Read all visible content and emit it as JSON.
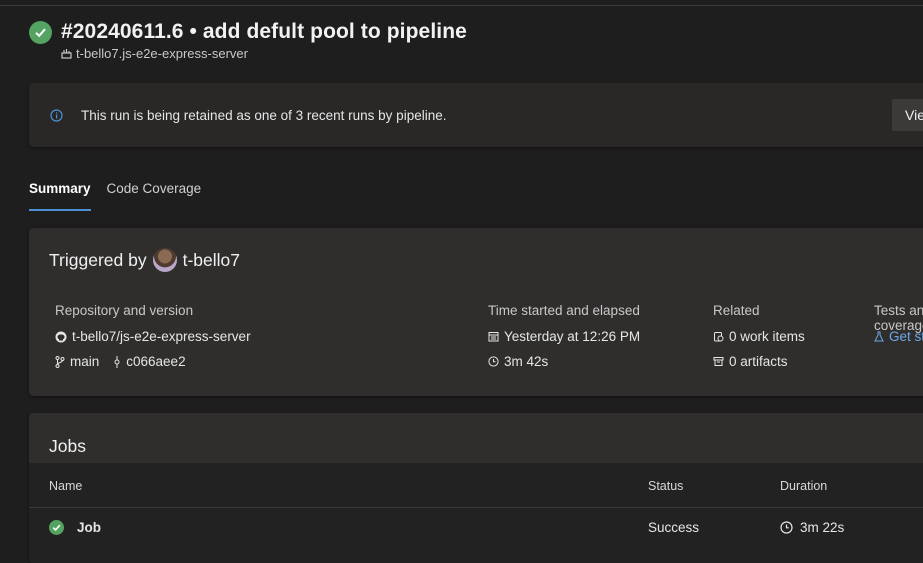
{
  "run": {
    "title": "#20240611.6 • add defult pool to pipeline",
    "repo_subtitle": "t-bello7.js-e2e-express-server"
  },
  "banner": {
    "message": "This run is being retained as one of 3 recent runs by pipeline.",
    "view_button": "View"
  },
  "tabs": [
    {
      "label": "Summary",
      "active": true
    },
    {
      "label": "Code Coverage",
      "active": false
    }
  ],
  "summary": {
    "triggered_prefix": "Triggered by",
    "user": "t-bello7",
    "repo_header": "Repository and version",
    "repo_name": "t-bello7/js-e2e-express-server",
    "branch": "main",
    "commit": "c066aee2",
    "time_header": "Time started and elapsed",
    "started": "Yesterday at 12:26 PM",
    "elapsed": "3m 42s",
    "related_header": "Related",
    "work_items": "0 work items",
    "artifacts": "0 artifacts",
    "tests_header": "Tests and coverage",
    "tests_link": "Get started"
  },
  "jobs": {
    "title": "Jobs",
    "columns": [
      "Name",
      "Status",
      "Duration"
    ],
    "rows": [
      {
        "name": "Job",
        "status": "Success",
        "duration": "3m 22s"
      }
    ]
  },
  "colors": {
    "success": "#55a362",
    "link": "#6ca8e8",
    "tab_underline": "#4c8fd6",
    "info": "#4c8fd6"
  },
  "icons": [
    "success-check-icon",
    "pipeline-icon",
    "info-icon",
    "avatar",
    "github-icon",
    "branch-icon",
    "commit-icon",
    "calendar-icon",
    "clock-icon",
    "work-item-icon",
    "artifact-icon",
    "flask-icon"
  ]
}
